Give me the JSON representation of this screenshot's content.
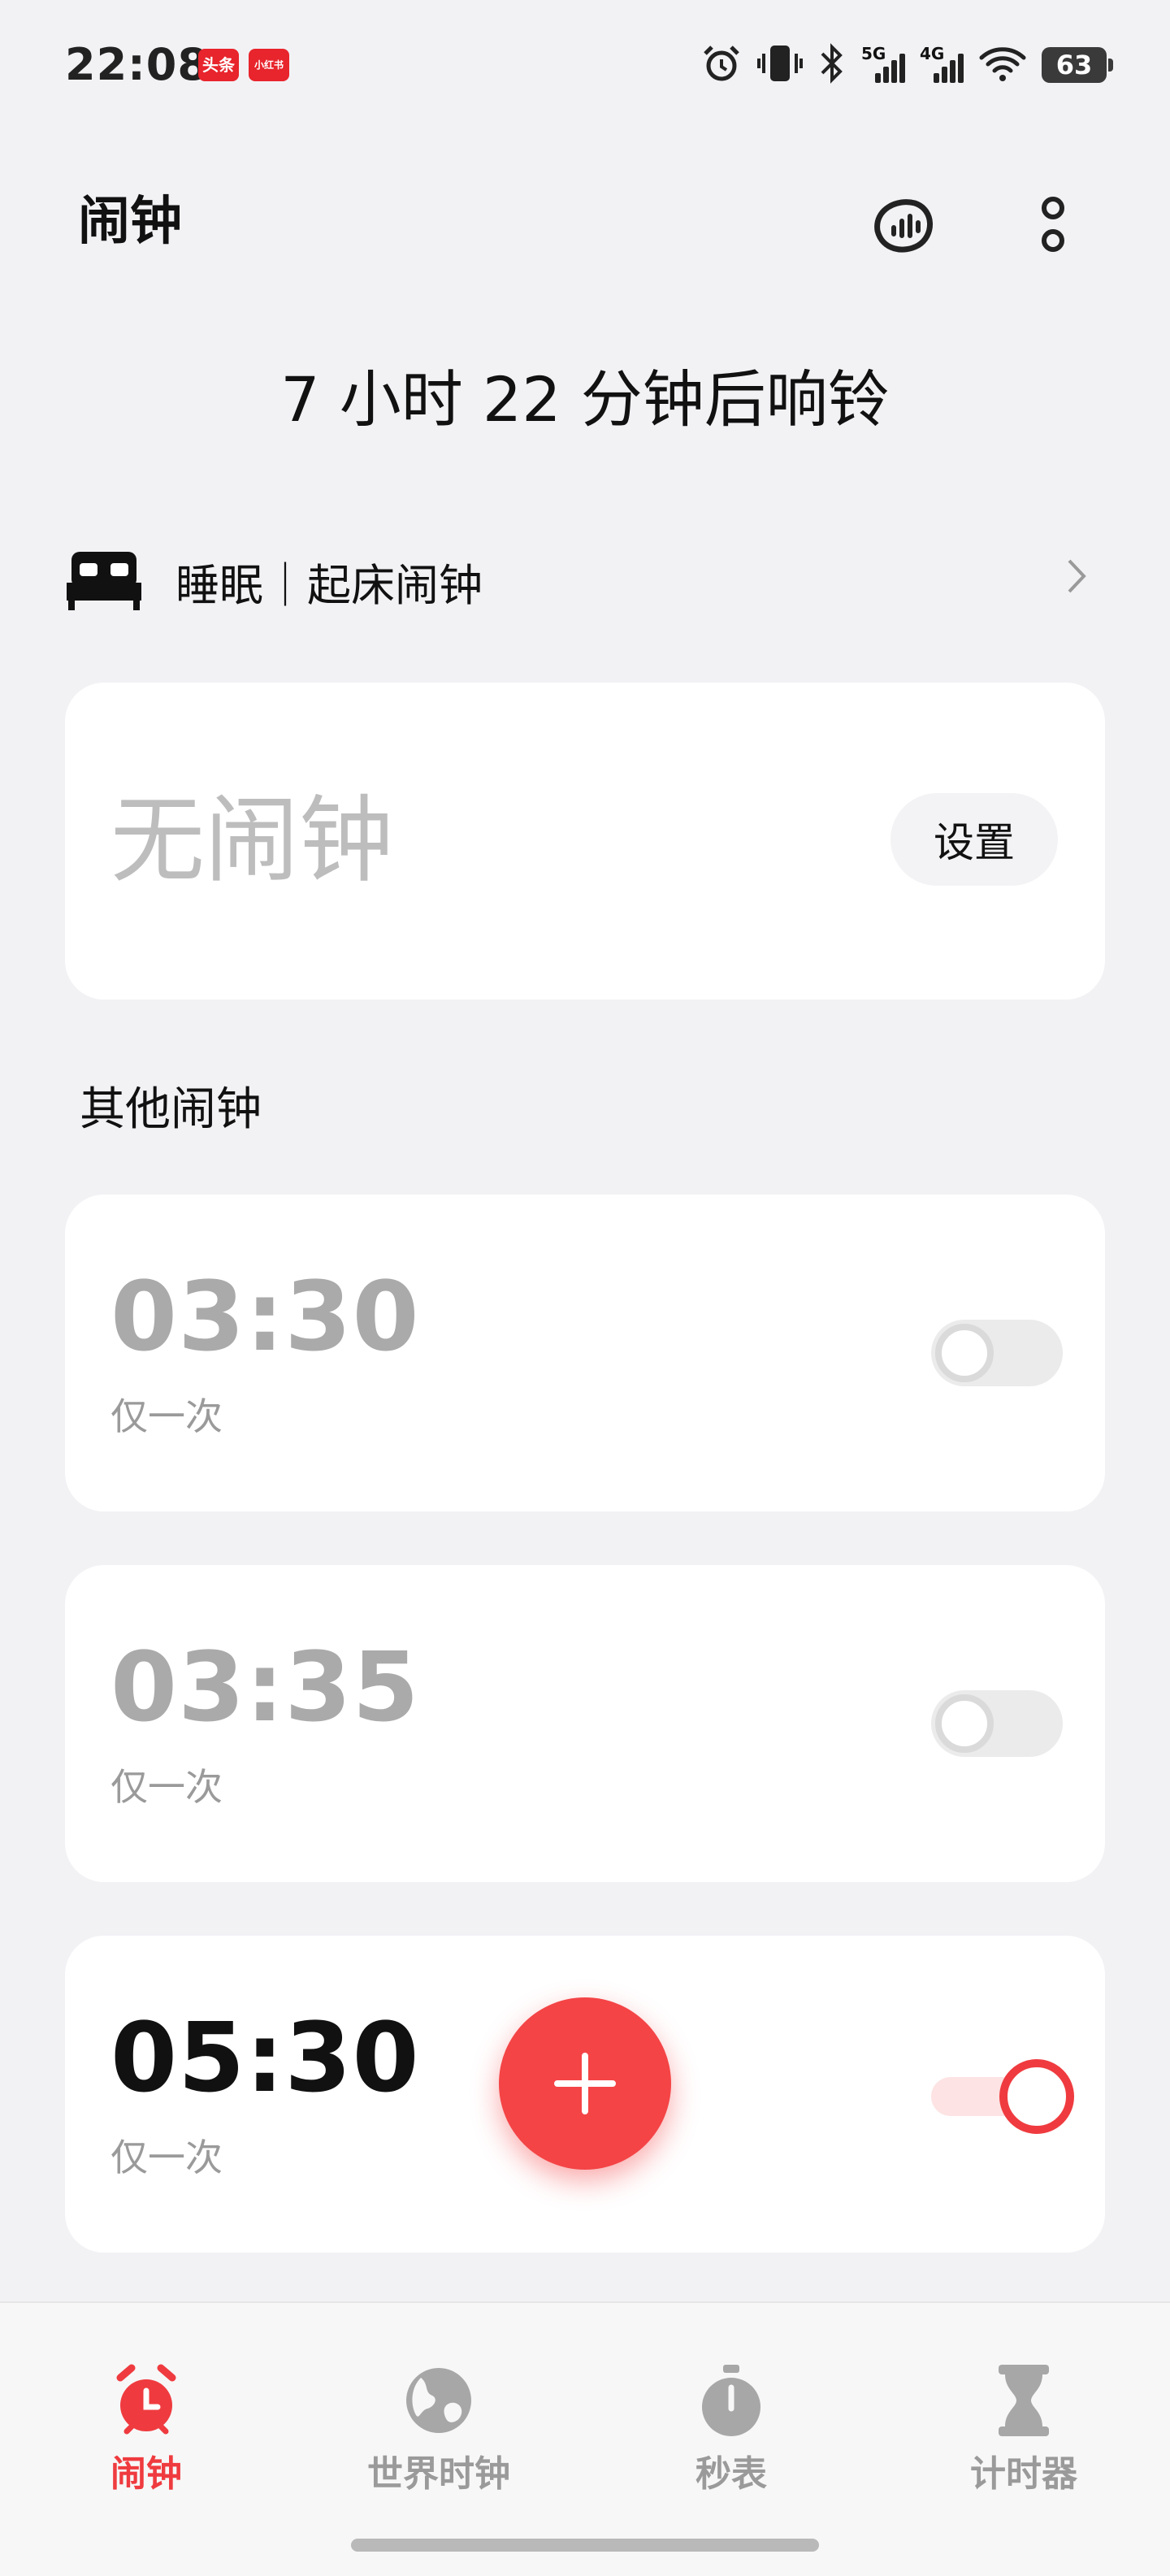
{
  "status_bar": {
    "time": "22:08",
    "badge_1": "头条",
    "badge_2": "小红书",
    "net1": "5G",
    "net2": "4G",
    "battery": "63",
    "icons": [
      "alarm-icon",
      "vibrate-icon",
      "bluetooth-icon",
      "signal-5g-icon",
      "signal-4g-icon",
      "wifi-icon",
      "battery-icon"
    ]
  },
  "header": {
    "title": "闹钟",
    "icons": [
      "sound-wave-icon",
      "more-vertical-icon"
    ]
  },
  "countdown": "7 小时 22 分钟后响铃",
  "sleep": {
    "label": "睡眠｜起床闹钟",
    "icon": "bed-icon"
  },
  "main_alarm": {
    "text": "无闹钟",
    "button": "设置"
  },
  "other": {
    "title": "其他闹钟",
    "alarms": [
      {
        "time": "03:30",
        "repeat": "仅一次",
        "enabled": false
      },
      {
        "time": "03:35",
        "repeat": "仅一次",
        "enabled": false
      },
      {
        "time": "05:30",
        "repeat": "仅一次",
        "enabled": true
      }
    ]
  },
  "fab_icon": "plus-icon",
  "nav": {
    "items": [
      {
        "label": "闹钟",
        "icon": "alarm-clock-icon",
        "active": true
      },
      {
        "label": "世界时钟",
        "icon": "globe-icon",
        "active": false
      },
      {
        "label": "秒表",
        "icon": "stopwatch-icon",
        "active": false
      },
      {
        "label": "计时器",
        "icon": "hourglass-icon",
        "active": false
      }
    ]
  },
  "colors": {
    "accent": "#ef3b3f",
    "background": "#f2f2f5",
    "card": "#ffffff"
  }
}
